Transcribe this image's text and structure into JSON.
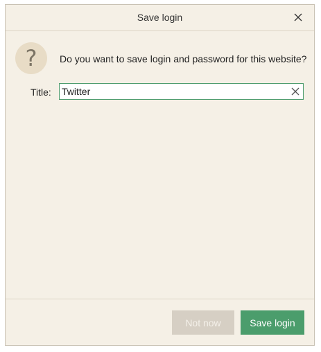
{
  "dialog": {
    "title": "Save login",
    "prompt": "Do you want to save login and password for this website?",
    "question_glyph": "?",
    "icons": {
      "close": "close-icon",
      "question": "question-mark-icon",
      "clear": "clear-input-icon"
    }
  },
  "form": {
    "title_label": "Title:",
    "title_value": "Twitter"
  },
  "buttons": {
    "not_now": "Not now",
    "save_login": "Save login"
  },
  "colors": {
    "background": "#f5f0e6",
    "accent": "#4b9d6c",
    "disabled_button": "#d6cfc4",
    "icon_circle": "#e8dcc6"
  }
}
